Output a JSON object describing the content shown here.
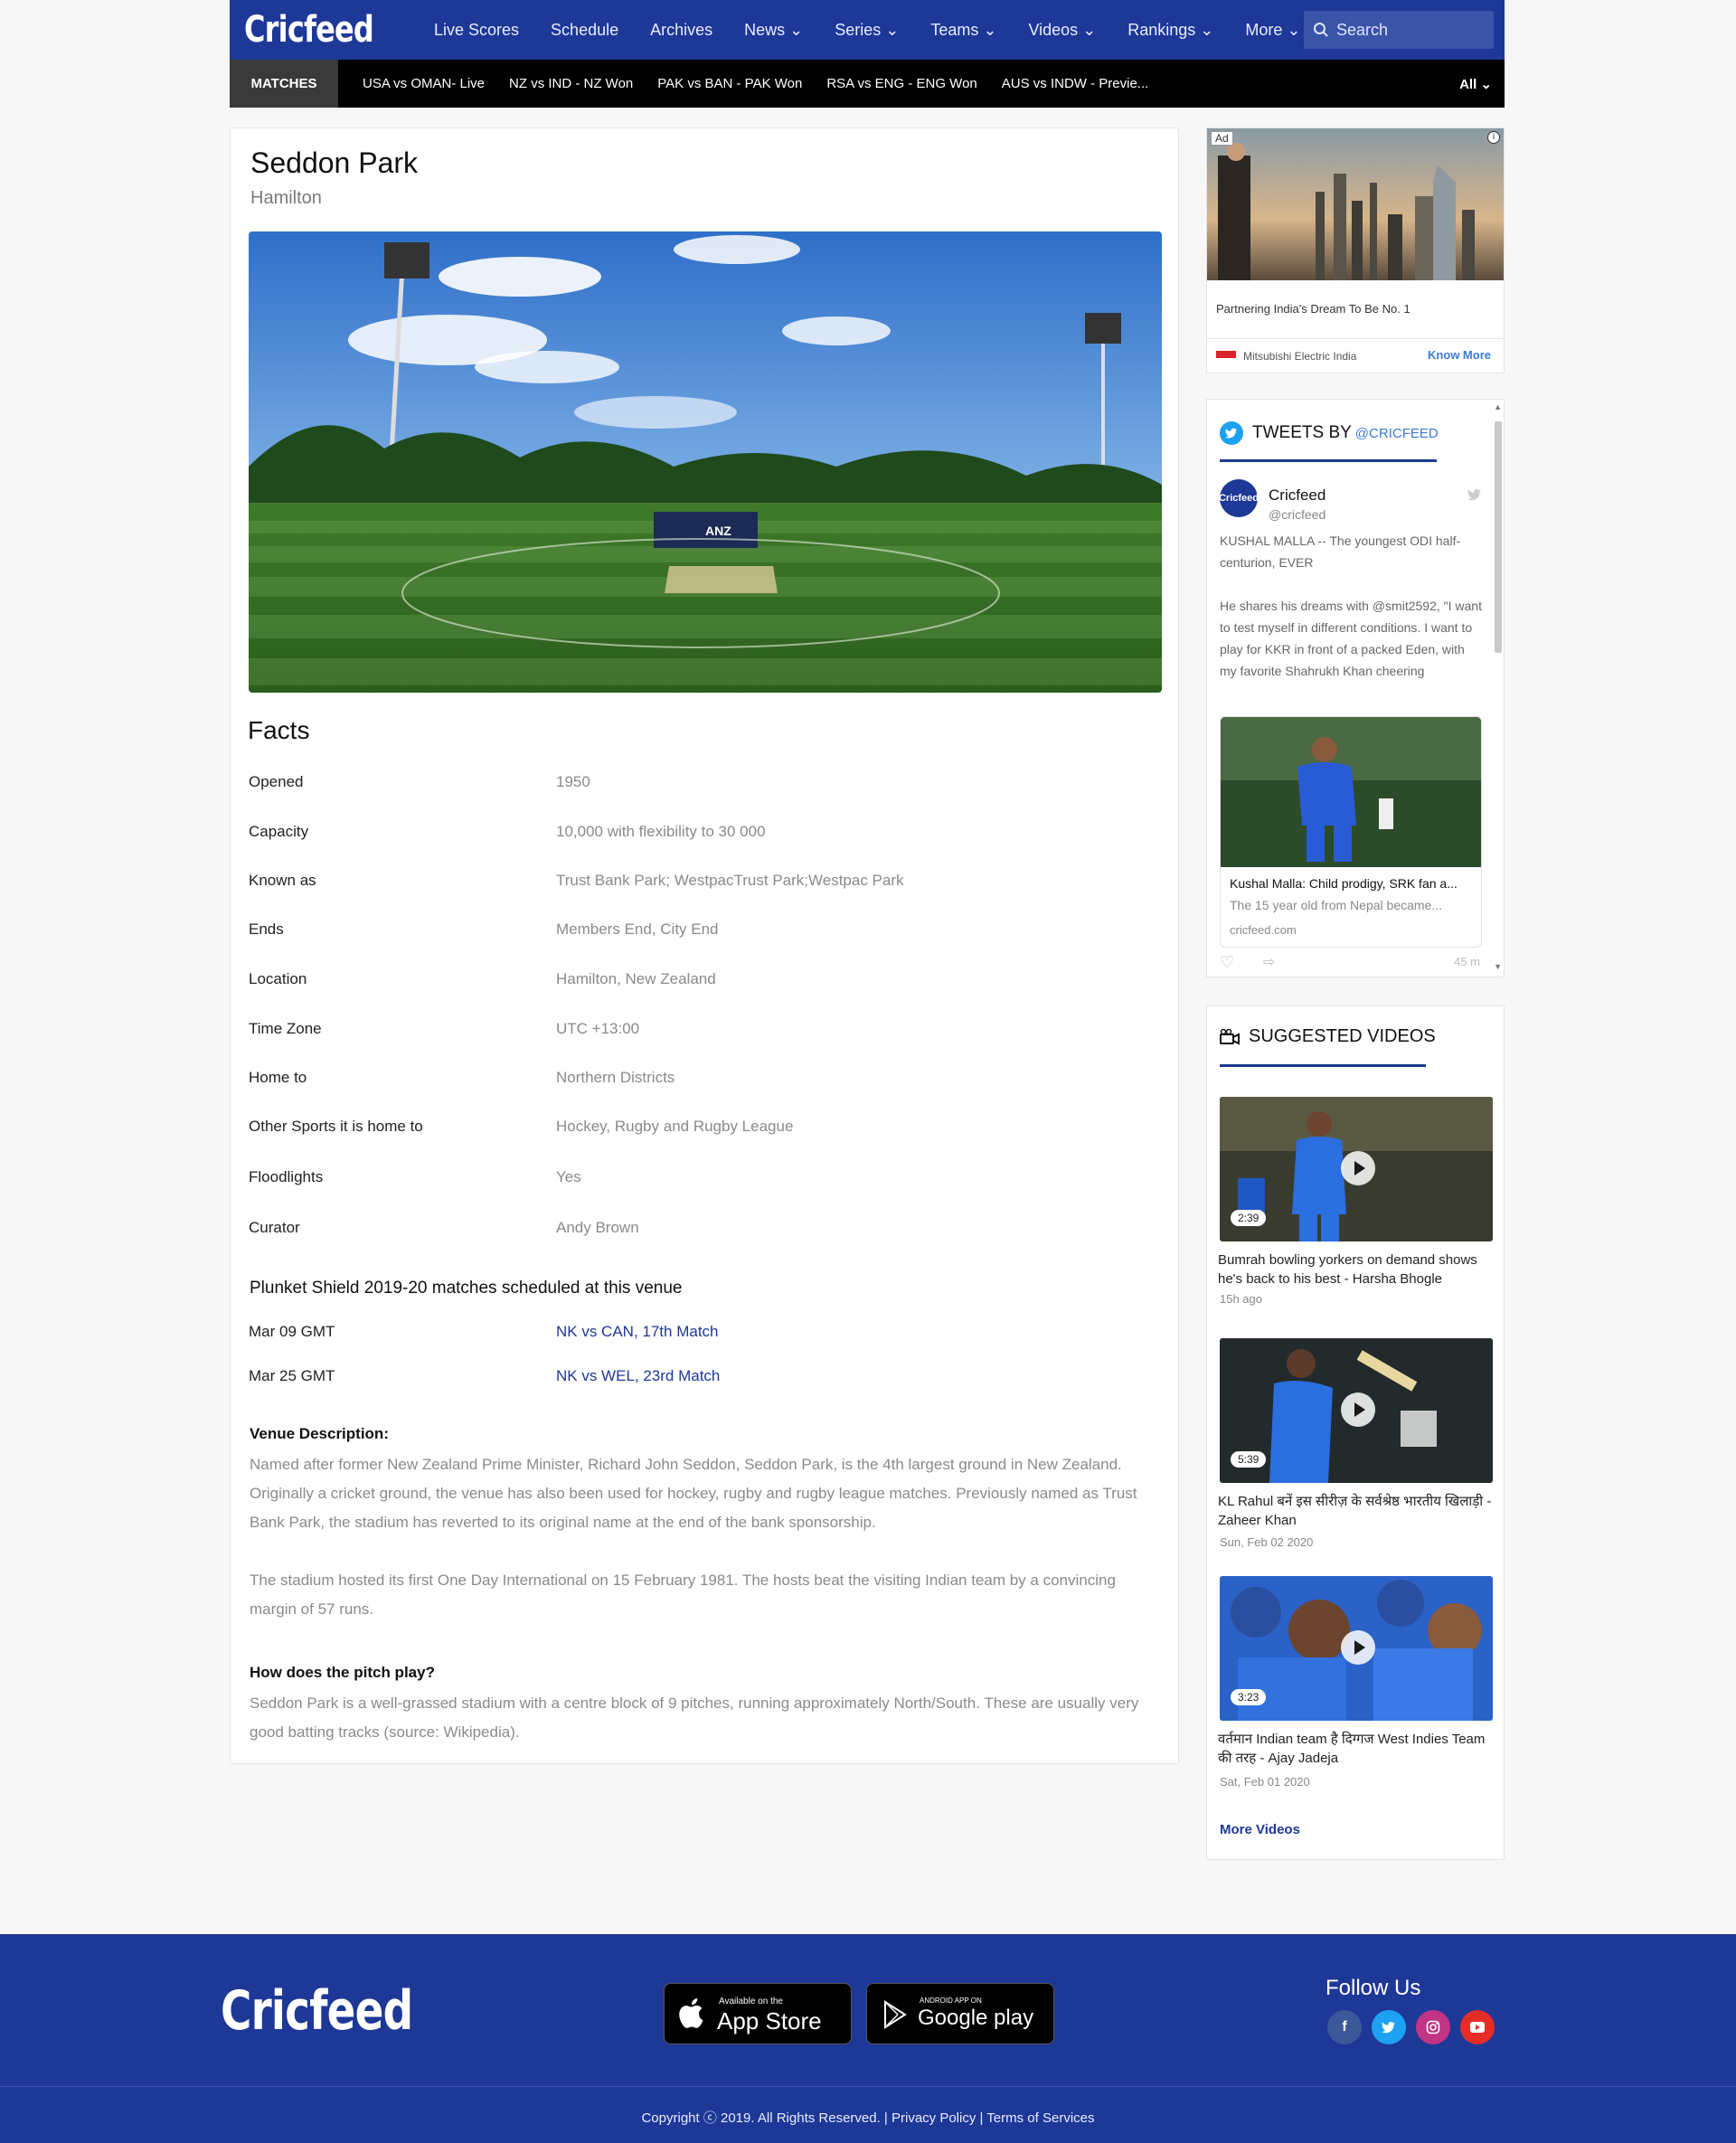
{
  "header": {
    "logo": "Cricfeed",
    "nav": [
      "Live Scores",
      "Schedule",
      "Archives",
      "News ⌄",
      "Series ⌄",
      "Teams ⌄",
      "Videos ⌄",
      "Rankings ⌄",
      "More ⌄"
    ],
    "search_placeholder": "Search"
  },
  "matchbar": {
    "label": "MATCHES",
    "items": [
      "USA vs OMAN- Live",
      "NZ vs IND - NZ Won",
      "PAK vs BAN - PAK Won",
      "RSA vs  ENG - ENG Won",
      "AUS vs INDW - Previe..."
    ],
    "filter": "All ⌄"
  },
  "venue": {
    "name": "Seddon Park",
    "city": "Hamilton",
    "facts_heading": "Facts",
    "facts": [
      {
        "label": "Opened",
        "value": "1950"
      },
      {
        "label": "Capacity",
        "value": "10,000 with flexibility to 30 000"
      },
      {
        "label": "Known as",
        "value": "Trust Bank Park; WestpacTrust Park;Westpac Park"
      },
      {
        "label": "Ends",
        "value": "Members End, City End"
      },
      {
        "label": "Location",
        "value": "Hamilton, New Zealand"
      },
      {
        "label": "Time Zone",
        "value": "UTC +13:00"
      },
      {
        "label": "Home to",
        "value": "Northern Districts"
      },
      {
        "label": "Other Sports it is home to",
        "value": "Hockey, Rugby and Rugby League"
      },
      {
        "label": "Floodlights",
        "value": "Yes"
      },
      {
        "label": "Curator",
        "value": "Andy Brown"
      }
    ],
    "schedule_heading": "Plunket Shield 2019-20 matches scheduled at this venue",
    "schedule": [
      {
        "date": "Mar 09 GMT",
        "match": "NK vs CAN, 17th Match"
      },
      {
        "date": "Mar 25 GMT",
        "match": "NK vs WEL, 23rd Match"
      }
    ],
    "description_heading": "Venue Description:",
    "description_p1": "Named after former New Zealand Prime Minister, Richard John Seddon, Seddon Park, is the 4th largest ground in New Zealand. Originally a cricket ground, the venue has also been used for hockey, rugby and rugby league matches. Previously named as Trust Bank Park, the stadium has reverted to its original name at the end of the bank sponsorship.",
    "description_p2": "The stadium hosted its first One Day International on 15 February 1981. The hosts beat the visiting Indian team by a convincing margin of 57 runs.",
    "pitch_heading": "How does the pitch play?",
    "pitch_text": "Seddon Park is a well-grassed stadium with a centre block of 9 pitches, running approximately North/South. These are usually very good batting tracks (source: Wikipedia).",
    "hero_banner": "ANZ"
  },
  "ad": {
    "tag": "Ad",
    "info": "i",
    "text": "Partnering India's Dream To Be No. 1",
    "brand": "Mitsubishi Electric India",
    "cta": "Know More"
  },
  "tweets": {
    "heading": "TWEETS BY",
    "handle_link": "@CRICFEED",
    "avatar_text": "Cricfeed",
    "name": "Cricfeed",
    "handle": "@cricfeed",
    "text1": "KUSHAL MALLA -- The youngest ODI half-centurion, EVER",
    "text2": "He shares his dreams with @smit2592, \"I want to test myself in different conditions. I want to play for KKR in front of a packed Eden, with my favorite Shahrukh Khan cheering",
    "card_title": "Kushal Malla: Child prodigy, SRK fan a...",
    "card_desc": "The 15 year old from Nepal became...",
    "card_url": "cricfeed.com",
    "time": "45 m"
  },
  "videos": {
    "heading": "SUGGESTED VIDEOS",
    "items": [
      {
        "duration": "2:39",
        "title": "Bumrah bowling yorkers on demand shows he's back to his best - Harsha Bhogle",
        "time": "15h ago"
      },
      {
        "duration": "5:39",
        "title": "KL Rahul बनें इस सीरीज़ के सर्वश्रेष्ठ भारतीय खिलाड़ी - Zaheer Khan",
        "time": "Sun, Feb 02 2020"
      },
      {
        "duration": "3:23",
        "title": "वर्तमान Indian team है दिग्गज West Indies Team की तरह - Ajay Jadeja",
        "time": "Sat, Feb 01 2020"
      }
    ],
    "more": "More Videos"
  },
  "footer": {
    "logo": "Cricfeed",
    "appstore_small": "Available on the",
    "appstore_big": "App Store",
    "play_small": "ANDROID APP ON",
    "play_big": "Google play",
    "follow": "Follow Us",
    "copyright": "Copyright ⓒ 2019. All Rights Reserved.  |  Privacy Policy  |  Terms of Services"
  },
  "colors": {
    "brand": "#1e3897",
    "matchbar": "#000000",
    "link": "#1e3897"
  }
}
